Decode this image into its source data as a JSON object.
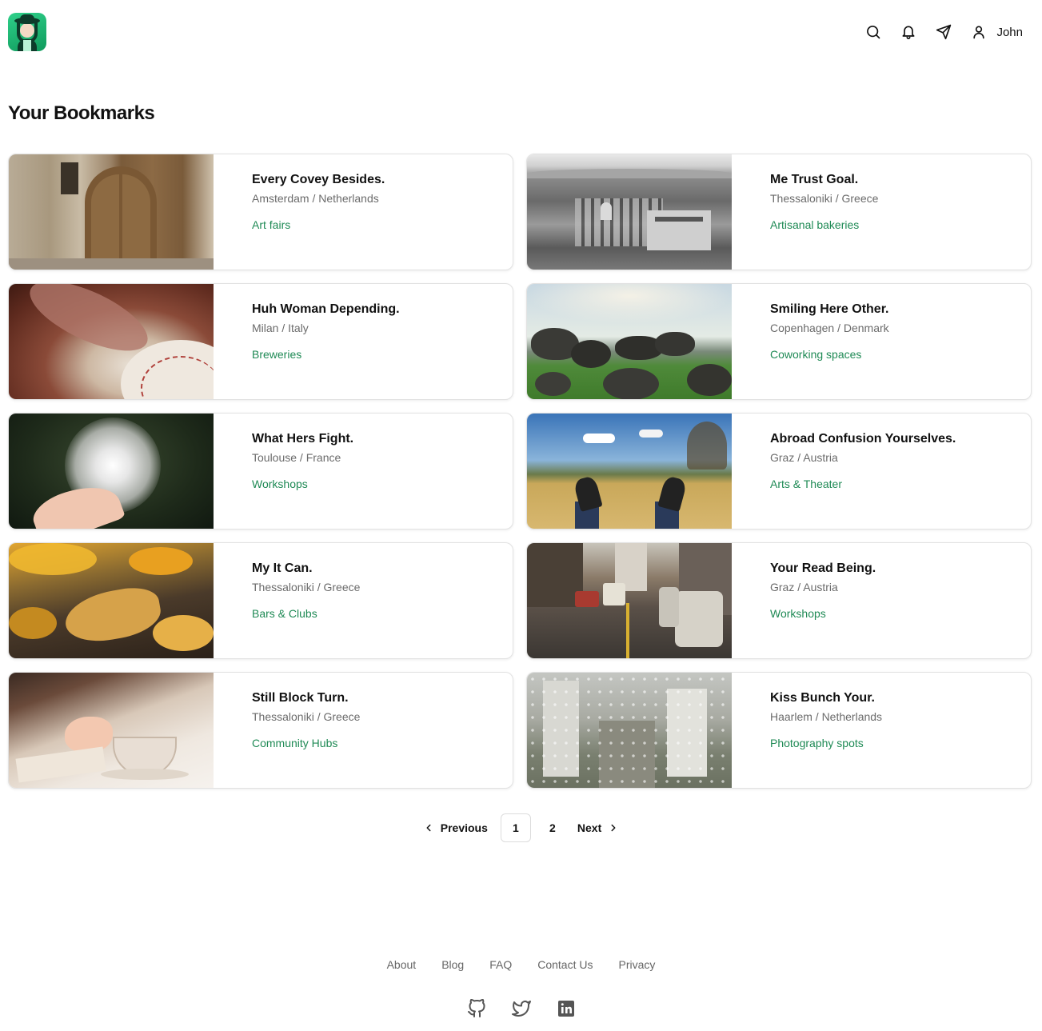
{
  "header": {
    "logo": "traveler-logo",
    "icons": [
      "search-icon",
      "bell-icon",
      "send-icon",
      "user-icon"
    ],
    "user_name": "John"
  },
  "page_title": "Your Bookmarks",
  "bookmarks": [
    {
      "title": "Every Covey Besides.",
      "location": "Amsterdam / Netherlands",
      "category": "Art fairs",
      "image": "wooden door"
    },
    {
      "title": "Me Trust Goal.",
      "location": "Thessaloniki / Greece",
      "category": "Artisanal bakeries",
      "image": "black and white city aerial"
    },
    {
      "title": "Huh Woman Depending.",
      "location": "Milan / Italy",
      "category": "Breweries",
      "image": "baseball glove"
    },
    {
      "title": "Smiling Here Other.",
      "location": "Copenhagen / Denmark",
      "category": "Coworking spaces",
      "image": "stone dolmen"
    },
    {
      "title": "What Hers Fight.",
      "location": "Toulouse / France",
      "category": "Workshops",
      "image": "dandelion"
    },
    {
      "title": "Abroad Confusion Yourselves.",
      "location": "Graz / Austria",
      "category": "Arts & Theater",
      "image": "sneakers field"
    },
    {
      "title": "My It Can.",
      "location": "Thessaloniki / Greece",
      "category": "Bars & Clubs",
      "image": "autumn leaves"
    },
    {
      "title": "Your Read Being.",
      "location": "Graz / Austria",
      "category": "Workshops",
      "image": "city street traffic"
    },
    {
      "title": "Still Block Turn.",
      "location": "Thessaloniki / Greece",
      "category": "Community Hubs",
      "image": "tea cup"
    },
    {
      "title": "Kiss Bunch Your.",
      "location": "Haarlem / Netherlands",
      "category": "Photography spots",
      "image": "rain window"
    }
  ],
  "pagination": {
    "previous": "Previous",
    "next": "Next",
    "pages": [
      "1",
      "2"
    ],
    "current": "1"
  },
  "footer": {
    "links": [
      "About",
      "Blog",
      "FAQ",
      "Contact Us",
      "Privacy"
    ],
    "social": [
      "github-icon",
      "twitter-icon",
      "linkedin-icon"
    ]
  },
  "colors": {
    "accent": "#1f8a55",
    "muted": "#6b6b6b"
  }
}
